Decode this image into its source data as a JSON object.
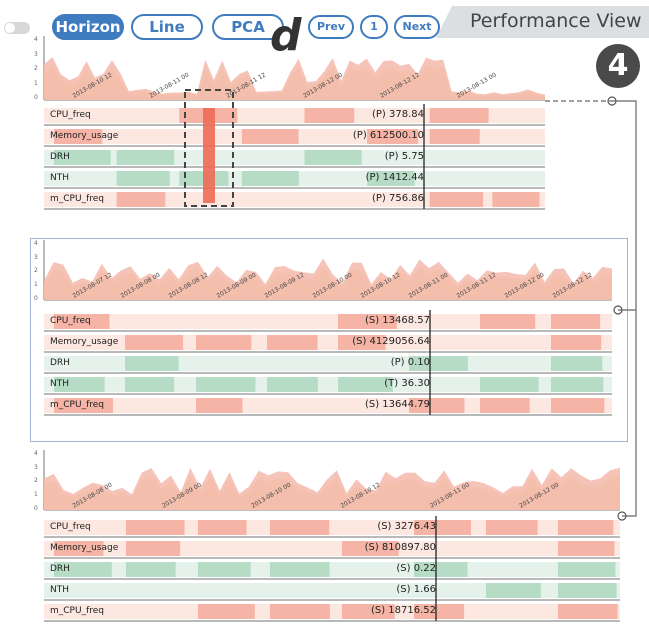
{
  "toolbar": {
    "buttons": [
      "Horizon",
      "Line",
      "PCA"
    ],
    "active": "Horizon",
    "prev_label": "Prev",
    "page": "1",
    "next_label": "Next"
  },
  "view_title": "Performance View",
  "annotation_letter": "d",
  "badge_number": "4",
  "colors": {
    "accent": "#3f7bbf",
    "red": "#f08a76",
    "green": "#9bd1b3",
    "blue": "#8fa6c2",
    "yellow": "#efe4a6"
  },
  "y_ticks": [
    "4",
    "3",
    "2",
    "1",
    "0"
  ],
  "panels": [
    {
      "date_labels": [
        "2013-08-10 12",
        "2013-08-11 00",
        "2013-08-11 12",
        "2013-08-12 00",
        "2013-08-12 12",
        "2013-08-13 00"
      ],
      "rows": [
        {
          "label": "CPU_freq",
          "value": "(P) 378.84"
        },
        {
          "label": "Memory_usage",
          "value": "(P) 612500.10"
        },
        {
          "label": "DRH",
          "value": "(P) 5.75"
        },
        {
          "label": "NTH",
          "value": "(P) 1412.44"
        },
        {
          "label": "m_CPU_freq",
          "value": "(P) 756.86"
        }
      ]
    },
    {
      "date_labels": [
        "2013-08-07 12",
        "2013-08-08 00",
        "2013-08-08 12",
        "2013-08-09 00",
        "2013-08-09 12",
        "2013-08-10 00",
        "2013-08-10 12",
        "2013-08-11 00",
        "2013-08-11 12",
        "2013-08-12 00",
        "2013-08-12 12"
      ],
      "rows": [
        {
          "label": "CPU_freq",
          "value": "(S) 13468.57"
        },
        {
          "label": "Memory_usage",
          "value": "(S) 4129056.64"
        },
        {
          "label": "DRH",
          "value": "(P) 0.10"
        },
        {
          "label": "NTH",
          "value": "(T) 36.30"
        },
        {
          "label": "m_CPU_freq",
          "value": "(S) 13644.79"
        }
      ]
    },
    {
      "date_labels": [
        "2013-08-08 00",
        "2013-08-09 00",
        "2013-08-10 00",
        "2013-08-10 12",
        "2013-08-11 00",
        "2013-08-12 00"
      ],
      "rows": [
        {
          "label": "CPU_freq",
          "value": "(S) 3276.43"
        },
        {
          "label": "Memory_usage",
          "value": "(S) 810897.80"
        },
        {
          "label": "DRH",
          "value": "(S) 0.22"
        },
        {
          "label": "NTH",
          "value": "(S) 1.66"
        },
        {
          "label": "m_CPU_freq",
          "value": "(S) 18716.52"
        }
      ]
    }
  ]
}
